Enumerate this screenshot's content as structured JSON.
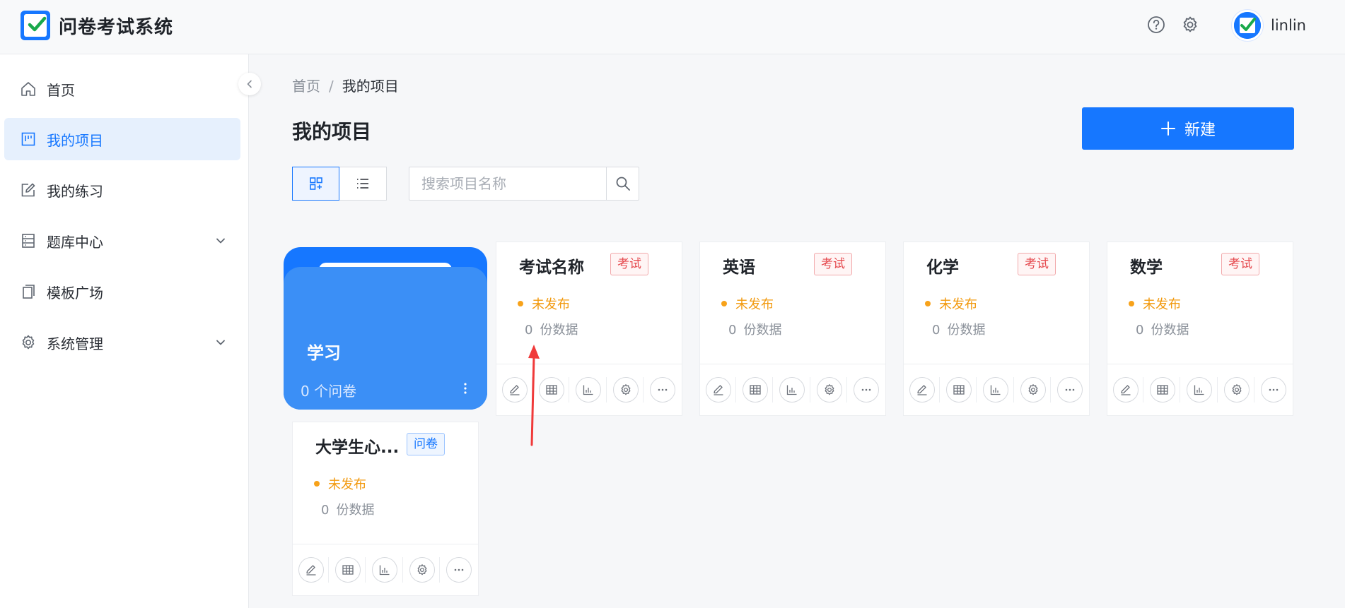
{
  "header": {
    "app_title": "问卷考试系统",
    "help_icon": "question-circle-icon",
    "settings_icon": "gear-icon",
    "username": "linlin"
  },
  "sidebar": {
    "items": [
      {
        "label": "首页",
        "icon": "home-icon",
        "active": false,
        "expandable": false
      },
      {
        "label": "我的项目",
        "icon": "project-board-icon",
        "active": true,
        "expandable": false
      },
      {
        "label": "我的练习",
        "icon": "edit-icon",
        "active": false,
        "expandable": false
      },
      {
        "label": "题库中心",
        "icon": "database-icon",
        "active": false,
        "expandable": true
      },
      {
        "label": "模板广场",
        "icon": "copy-icon",
        "active": false,
        "expandable": false
      },
      {
        "label": "系统管理",
        "icon": "gear-icon",
        "active": false,
        "expandable": true
      }
    ]
  },
  "breadcrumb": {
    "home": "首页",
    "separator": "/",
    "current": "我的项目"
  },
  "page": {
    "title": "我的项目",
    "new_button": "新建",
    "search_placeholder": "搜索项目名称",
    "view_mode": "grid"
  },
  "folder": {
    "name": "学习",
    "count_text": "0 个问卷"
  },
  "projects": [
    {
      "title": "考试名称",
      "tag": "考试",
      "tag_type": "exam",
      "status": "未发布",
      "count": "0",
      "count_unit": "份数据"
    },
    {
      "title": "英语",
      "tag": "考试",
      "tag_type": "exam",
      "status": "未发布",
      "count": "0",
      "count_unit": "份数据"
    },
    {
      "title": "化学",
      "tag": "考试",
      "tag_type": "exam",
      "status": "未发布",
      "count": "0",
      "count_unit": "份数据"
    },
    {
      "title": "数学",
      "tag": "考试",
      "tag_type": "exam",
      "status": "未发布",
      "count": "0",
      "count_unit": "份数据"
    },
    {
      "title": "大学生心...",
      "tag": "问卷",
      "tag_type": "survey",
      "status": "未发布",
      "count": "0",
      "count_unit": "份数据"
    }
  ],
  "card_actions": [
    "edit-icon",
    "table-icon",
    "chart-icon",
    "settings-icon",
    "more-icon"
  ],
  "colors": {
    "primary": "#1677ff",
    "folder": "#3b8ff6",
    "warning": "#f29a0f",
    "exam_tag": "#e5484d",
    "annotation_arrow": "#f03a3a"
  }
}
